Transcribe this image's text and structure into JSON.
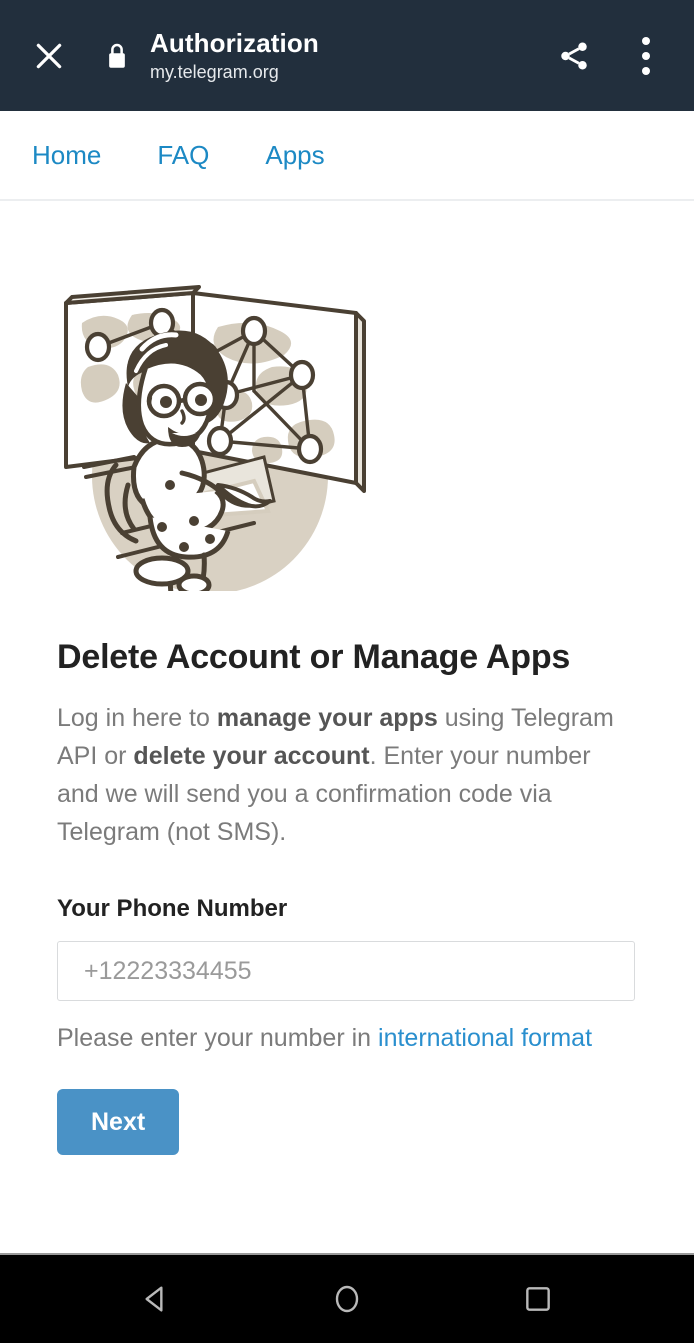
{
  "appbar": {
    "close_icon": "close-icon",
    "lock_icon": "lock-icon",
    "title": "Authorization",
    "subtitle": "my.telegram.org",
    "share_icon": "share-icon",
    "overflow_icon": "more-vertical-icon",
    "background_color": "#222f3d"
  },
  "sitenav": {
    "link_color": "#1c89c4",
    "items": [
      {
        "label": "Home"
      },
      {
        "label": "FAQ"
      },
      {
        "label": "Apps"
      }
    ]
  },
  "illustration": {
    "name": "telegram-datacenter-illustration",
    "alt": "Woman with glasses seated in front of screens showing a world map with network nodes",
    "line_color": "#4a4033",
    "fill_color": "#d5cdbe"
  },
  "main": {
    "title": "Delete Account or Manage Apps",
    "intro": {
      "part1": "Log in here to ",
      "bold1": "manage your apps",
      "part2": " using Telegram API or ",
      "bold2": "delete your account",
      "part3": ". Enter your number and we will send you a confirmation code via Telegram (not SMS)."
    },
    "phone": {
      "label": "Your Phone Number",
      "value": "",
      "placeholder": "+12223334455"
    },
    "help": {
      "text": "Please enter your number in ",
      "link_label": "international format"
    },
    "next_button": {
      "label": "Next",
      "color": "#4a92c6"
    }
  },
  "navbar": {
    "back_icon": "triangle-back-icon",
    "home_icon": "circle-home-icon",
    "recents_icon": "square-recents-icon"
  }
}
